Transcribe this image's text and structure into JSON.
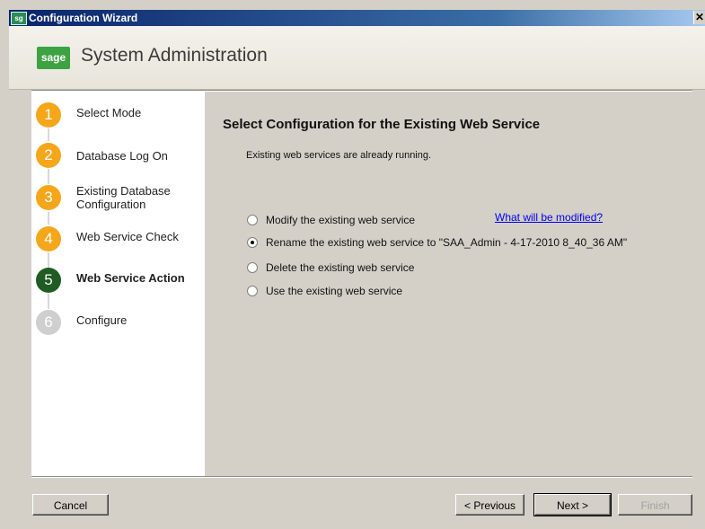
{
  "window": {
    "title": "Configuration Wizard",
    "close_glyph": "✕",
    "app_icon": "sage-app-icon"
  },
  "header": {
    "logo_text": "sage",
    "title": "System Administration"
  },
  "steps": [
    {
      "number": "1",
      "label": "Select Mode",
      "state": "done"
    },
    {
      "number": "2",
      "label": "Database Log On",
      "state": "done"
    },
    {
      "number": "3",
      "label": "Existing Database Configuration",
      "state": "done"
    },
    {
      "number": "4",
      "label": "Web Service Check",
      "state": "done"
    },
    {
      "number": "5",
      "label": "Web Service Action",
      "state": "current"
    },
    {
      "number": "6",
      "label": "Configure",
      "state": "pending"
    }
  ],
  "content": {
    "title": "Select Configuration for the Existing Web Service",
    "subtitle": "Existing web services are already running.",
    "options": [
      {
        "label": "Modify the existing web service",
        "checked": false
      },
      {
        "label": "Rename the existing web service to \"SAA_Admin - 4-17-2010 8_40_36 AM\"",
        "checked": true
      },
      {
        "label": "Delete the existing web service",
        "checked": false
      },
      {
        "label": "Use the existing web service",
        "checked": false
      }
    ],
    "link_text": "What will be modified?"
  },
  "buttons": {
    "cancel": "Cancel",
    "previous": "< Previous",
    "next": "Next >",
    "finish": "Finish"
  },
  "colors": {
    "step_done": "#f5a61b",
    "step_current": "#1e5c24",
    "step_pending": "#cfcfcf",
    "brand_green": "#3da342"
  }
}
